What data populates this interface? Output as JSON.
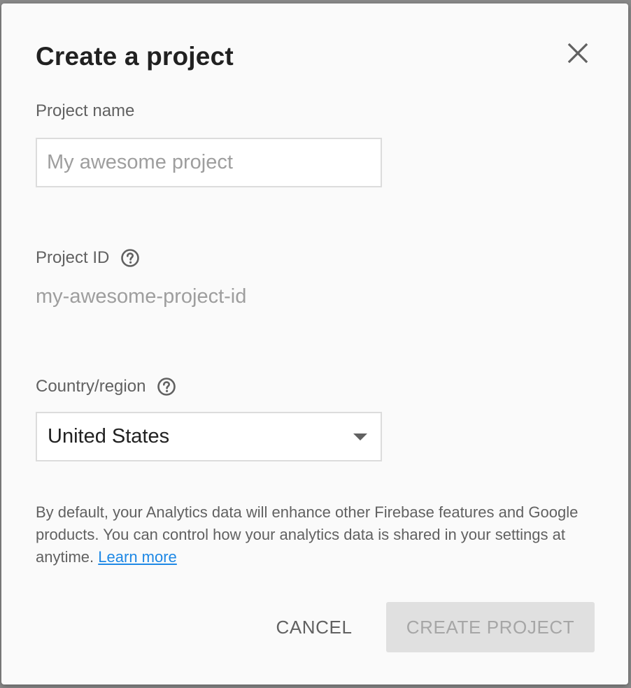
{
  "dialog": {
    "title": "Create a project",
    "close_icon": "close-icon"
  },
  "project_name": {
    "label": "Project name",
    "value": "",
    "placeholder": "My awesome project"
  },
  "project_id": {
    "label": "Project ID",
    "help_icon": "help-circle-icon",
    "value": "my-awesome-project-id"
  },
  "country": {
    "label": "Country/region",
    "help_icon": "help-circle-icon",
    "selected": "United States",
    "arrow_icon": "dropdown-arrow-icon"
  },
  "disclaimer": {
    "text": "By default, your Analytics data will enhance other Firebase features and Google products. You can control how your analytics data is shared in your settings at anytime.",
    "link_text": "Learn more"
  },
  "actions": {
    "cancel_label": "CANCEL",
    "create_label": "CREATE PROJECT",
    "create_enabled": false
  },
  "colors": {
    "dialog_background": "#fafafa",
    "title_text": "#212121",
    "secondary_text": "#616161",
    "placeholder_text": "#9e9e9e",
    "link": "#1e88e5",
    "disabled_button_bg": "#e0e0e0",
    "disabled_button_text": "#a6a6a6"
  }
}
